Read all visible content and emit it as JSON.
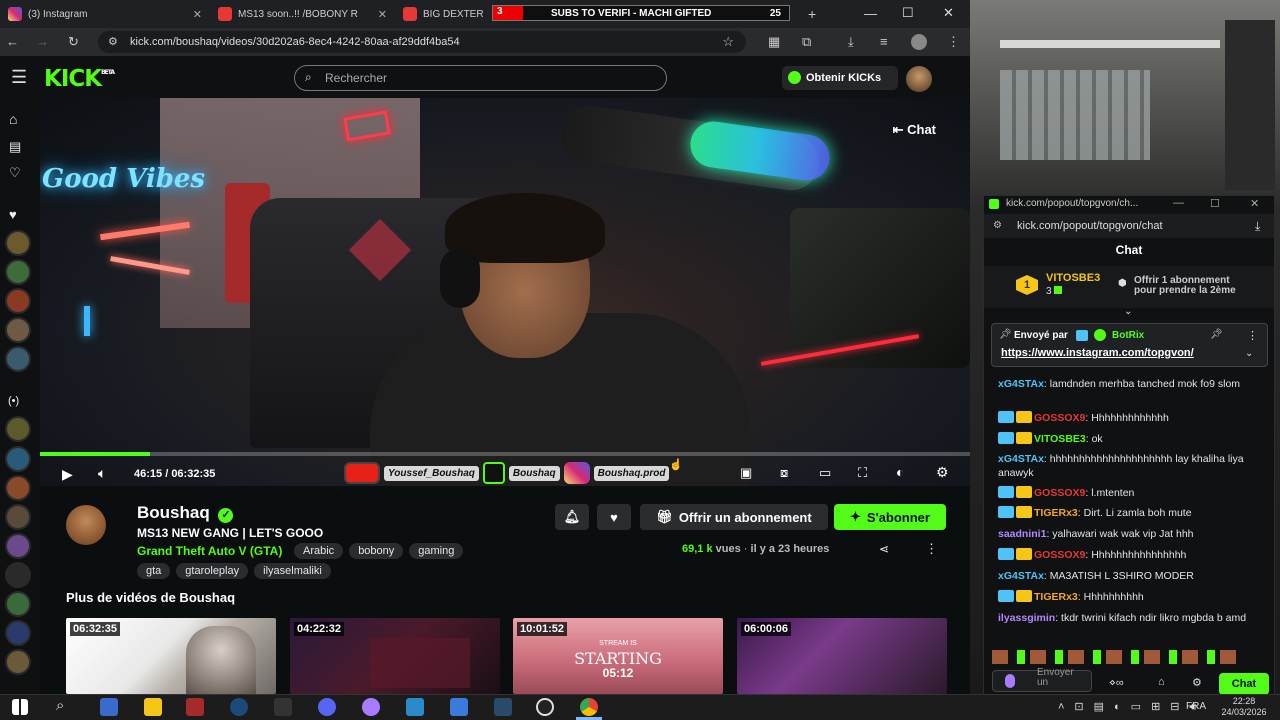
{
  "browser": {
    "tabs": [
      {
        "title": "(3) Instagram",
        "color": "#d62976"
      },
      {
        "title": "MS13 soon..!! /BOBONY R",
        "color": "#e53935"
      },
      {
        "title": "BIG DEXTER",
        "color": "#e53935"
      }
    ],
    "subs_bar": {
      "left_number": "3",
      "text": "SUBS TO VERIFI - MACHI GIFTED",
      "right_number": "25"
    },
    "url": "kick.com/boushaq/videos/30d202a6-8ec4-4242-80aa-af29ddf4ba54"
  },
  "kick": {
    "logo": "KICK",
    "logo_sup": "BETA",
    "search_placeholder": "Rechercher",
    "get_kicks_label": "Obtenir KICKs"
  },
  "video": {
    "chat_toggle": "Chat",
    "time_current": "46:15",
    "time_total": "06:32:35",
    "progress": 0.118,
    "neon_sign": "Good Vibes",
    "socials": [
      "Youssef_Boushaq",
      "Boushaq",
      "Boushaq.prod"
    ]
  },
  "channel": {
    "name": "Boushaq",
    "title": "MS13 NEW GANG | LET'S GOOO",
    "category": "Grand Theft Auto V (GTA)",
    "tags_row1": [
      "Arabic",
      "bobony",
      "gaming"
    ],
    "tags_row2": [
      "gta",
      "gtaroleplay",
      "ilyaselmaliki"
    ],
    "views": "69,1 k",
    "views_label": "vues",
    "age": "il y a 23 heures",
    "gift_label": "Offrir un abonnement",
    "subscribe_label": "S'abonner",
    "accent": "#53fc18"
  },
  "more_videos": {
    "heading": "Plus de vidéos de Boushaq",
    "items": [
      {
        "duration": "06:32:35"
      },
      {
        "duration": "04:22:32"
      },
      {
        "duration": "10:01:52",
        "caption": "STARTING",
        "sub": "05:12",
        "top": "STREAM IS"
      },
      {
        "duration": "06:00:06"
      }
    ]
  },
  "popout": {
    "window_title": "kick.com/popout/topgvon/ch...",
    "address": "kick.com/popout/topgvon/chat",
    "header": "Chat",
    "gifter": {
      "name": "VITOSBE3",
      "count": "3",
      "offer_line1": "Offrir 1 abonnement",
      "offer_line2": "pour prendre la 2ème"
    },
    "pinned": {
      "sent_by": "Envoyé par",
      "bot": "BotRix",
      "link": "https://www.instagram.com/topgvon/"
    },
    "messages": [
      {
        "user": "xG4STAx",
        "color": "#4fc3f7",
        "text": "lamdnden merhba tanched mok fo9 slom"
      },
      {
        "user": "GOSSOX9",
        "color": "#e53935",
        "text": "Hhhhhhhhhhhhh"
      },
      {
        "user": "VITOSBE3",
        "color": "#53fc18",
        "text": "ok"
      },
      {
        "user": "xG4STAx",
        "color": "#4fc3f7",
        "text": "hhhhhhhhhhhhhhhhhhhhh lay khaliha liya anawyk"
      },
      {
        "user": "GOSSOX9",
        "color": "#e53935",
        "text": "l.mtenten"
      },
      {
        "user": "TIGERx3",
        "color": "#f5a623",
        "text": "Dirt. Li zamla boh mute"
      },
      {
        "user": "saadnini1",
        "color": "#b388ff",
        "text": "yalhawari wak wak vip Jat hhh"
      },
      {
        "user": "GOSSOX9",
        "color": "#e53935",
        "text": "Hhhhhhhhhhhhhhhh"
      },
      {
        "user": "xG4STAx",
        "color": "#4fc3f7",
        "text": "MA3ATISH L 3SHIRO MODER"
      },
      {
        "user": "TIGERx3",
        "color": "#f5a623",
        "text": "Hhhhhhhhhh"
      },
      {
        "user": "ilyassgimin",
        "color": "#b388ff",
        "text": "tkdr twrini kifach ndir likro mgbda b amd"
      }
    ],
    "send_placeholder": "Envoyer un",
    "chat_button": "Chat"
  },
  "taskbar": {
    "lang": "FRA",
    "time": "22:28",
    "date": "24/03/2026"
  }
}
